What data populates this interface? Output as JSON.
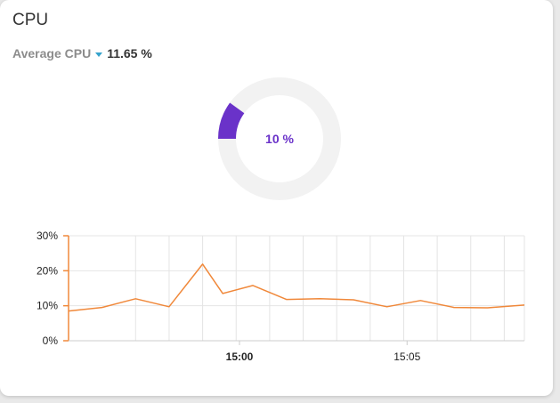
{
  "widget": {
    "title": "CPU",
    "metric_selector": {
      "label": "Average CPU",
      "value": "11.65 %"
    }
  },
  "gauge": {
    "label": "10 %",
    "value_percent": 10,
    "fill_color": "#6a32c9",
    "track_color": "#f2f2f2",
    "label_color": "#6a32c9"
  },
  "colors": {
    "caret": "#35a3cc",
    "line": "#f0883a",
    "axis": "#f0883a",
    "grid": "#e4e4e4"
  },
  "chart_data": {
    "type": "line",
    "y_ticks": [
      "30%",
      "20%",
      "10%",
      "0%"
    ],
    "ylim": [
      0,
      30
    ],
    "x_ticks": [
      {
        "label": "15:00",
        "minute": 0,
        "bold": true
      },
      {
        "label": "15:05",
        "minute": 5,
        "bold": false
      }
    ],
    "xlim_minutes": [
      -5.1,
      8.5
    ],
    "grid_minutes": [
      -3.1,
      -2.1,
      -1.1,
      -0.1,
      0.9,
      1.9,
      2.9,
      3.9,
      4.9,
      5.9,
      6.9,
      7.9
    ],
    "series": [
      {
        "points": [
          [
            -5.1,
            8.5
          ],
          [
            -4.1,
            9.5
          ],
          [
            -3.1,
            12
          ],
          [
            -2.1,
            9.7
          ],
          [
            -1.1,
            21.9
          ],
          [
            -0.5,
            13.5
          ],
          [
            0.4,
            15.8
          ],
          [
            1.4,
            11.8
          ],
          [
            2.4,
            12
          ],
          [
            3.4,
            11.7
          ],
          [
            4.4,
            9.7
          ],
          [
            5.4,
            11.5
          ],
          [
            6.4,
            9.5
          ],
          [
            7.4,
            9.4
          ],
          [
            8.5,
            10.2
          ]
        ]
      }
    ]
  }
}
